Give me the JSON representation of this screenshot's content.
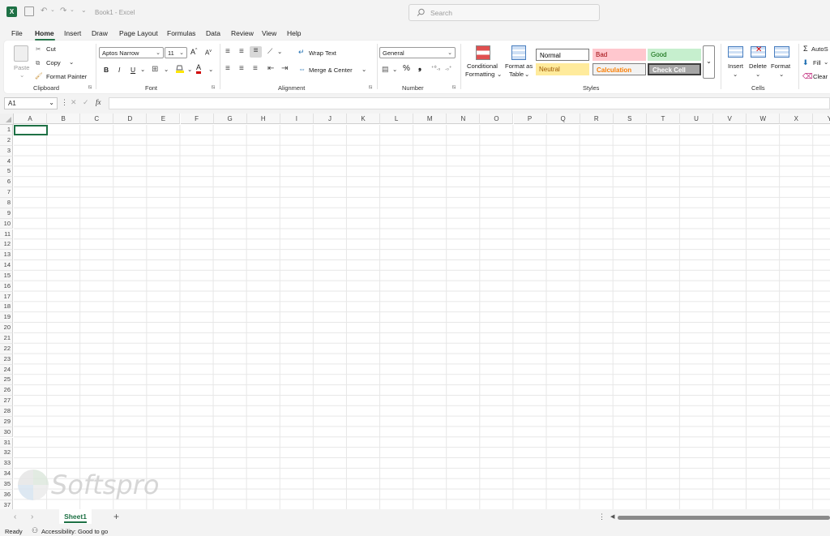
{
  "window": {
    "title": "Book1  -  Excel"
  },
  "search": {
    "placeholder": "Search"
  },
  "tabs": [
    "File",
    "Home",
    "Insert",
    "Draw",
    "Page Layout",
    "Formulas",
    "Data",
    "Review",
    "View",
    "Help"
  ],
  "active_tab": "Home",
  "ribbon": {
    "clipboard": {
      "paste": "Paste",
      "cut": "Cut",
      "copy": "Copy",
      "format_painter": "Format Painter",
      "label": "Clipboard"
    },
    "font": {
      "name": "Aptos Narrow",
      "size": "11",
      "bold": "B",
      "italic": "I",
      "underline": "U",
      "label": "Font"
    },
    "alignment": {
      "wrap_text": "Wrap Text",
      "merge_center": "Merge & Center",
      "label": "Alignment"
    },
    "number": {
      "format": "General",
      "label": "Number"
    },
    "styles": {
      "conditional_formatting_1": "Conditional",
      "conditional_formatting_2": "Formatting",
      "format_as_table_1": "Format as",
      "format_as_table_2": "Table",
      "cells": [
        {
          "name": "Normal"
        },
        {
          "name": "Bad"
        },
        {
          "name": "Good"
        },
        {
          "name": "Neutral"
        },
        {
          "name": "Calculation"
        },
        {
          "name": "Check Cell"
        }
      ],
      "label": "Styles"
    },
    "cells": {
      "insert": "Insert",
      "delete": "Delete",
      "format": "Format",
      "label": "Cells"
    },
    "editing": {
      "autosum": "AutoS",
      "fill": "Fill",
      "clear": "Clear"
    }
  },
  "formula_bar": {
    "name_box": "A1",
    "fx": "fx",
    "value": ""
  },
  "columns": [
    "A",
    "B",
    "C",
    "D",
    "E",
    "F",
    "G",
    "H",
    "I",
    "J",
    "K",
    "L",
    "M",
    "N",
    "O",
    "P",
    "Q",
    "R",
    "S",
    "T",
    "U",
    "V",
    "W",
    "X",
    "Y"
  ],
  "rows": [
    "1",
    "2",
    "3",
    "4",
    "5",
    "6",
    "7",
    "8",
    "9",
    "10",
    "11",
    "12",
    "13",
    "14",
    "15",
    "16",
    "17",
    "18",
    "19",
    "20",
    "21",
    "22",
    "23",
    "24",
    "25",
    "26",
    "27",
    "28",
    "29",
    "30",
    "31",
    "32",
    "33",
    "34",
    "35",
    "36",
    "37"
  ],
  "sheets": [
    {
      "name": "Sheet1",
      "active": true
    }
  ],
  "status": {
    "mode": "Ready",
    "accessibility": "Accessibility: Good to go"
  },
  "watermark": {
    "text": "Softspro"
  },
  "colors": {
    "accent": "#1e7145",
    "bad_bg": "#ffc7ce",
    "bad_fg": "#9c0006",
    "good_bg": "#c6efce",
    "good_fg": "#006100",
    "neutral_bg": "#ffeb9c",
    "neutral_fg": "#9c5700",
    "calc_bg": "#f2f2f2",
    "calc_fg": "#fa7d00",
    "check_bg": "#a5a5a5"
  }
}
